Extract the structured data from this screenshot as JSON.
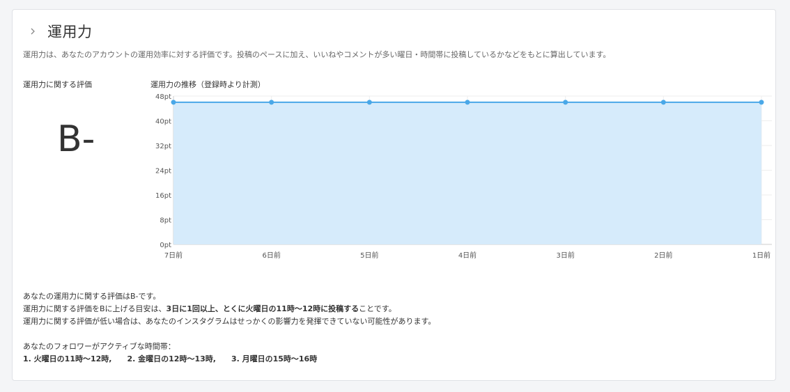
{
  "section": {
    "title": "運用力",
    "description": "運用力は、あなたのアカウントの運用効率に対する評価です。投稿のペースに加え、いいねやコメントが多い曜日・時間帯に投稿しているかなどをもとに算出しています。"
  },
  "evaluation": {
    "label": "運用力に関する評価",
    "grade": "B-"
  },
  "chart": {
    "label": "運用力の推移（登録時より計測）"
  },
  "chart_data": {
    "type": "area",
    "title": "運用力の推移（登録時より計測）",
    "categories": [
      "7日前",
      "6日前",
      "5日前",
      "4日前",
      "3日前",
      "2日前",
      "1日前"
    ],
    "values": [
      46,
      46,
      46,
      46,
      46,
      46,
      46
    ],
    "y_ticks": [
      "48pt",
      "40pt",
      "32pt",
      "24pt",
      "16pt",
      "8pt",
      "0pt"
    ],
    "ylim": [
      0,
      48
    ],
    "grid": true,
    "colors": {
      "line": "#4aa8e8",
      "fill": "#d6ebfb"
    }
  },
  "summary": {
    "line1": "あなたの運用力に関する評価はB-です。",
    "line2_prefix": "運用力に関する評価をBに上げる目安は、",
    "line2_bold": "3日に1回以上、とくに火曜日の11時〜12時に投稿する",
    "line2_suffix": "ことです。",
    "line3": "運用力に関する評価が低い場合は、あなたのインスタグラムはせっかくの影響力を発揮できていない可能性があります。"
  },
  "active_times": {
    "title": "あなたのフォロワーがアクティブな時間帯：",
    "items": [
      "1. 火曜日の11時〜12時,",
      "2. 金曜日の12時〜13時,",
      "3. 月曜日の15時〜16時"
    ]
  },
  "icons": {
    "expand": "chevron-right-icon"
  }
}
